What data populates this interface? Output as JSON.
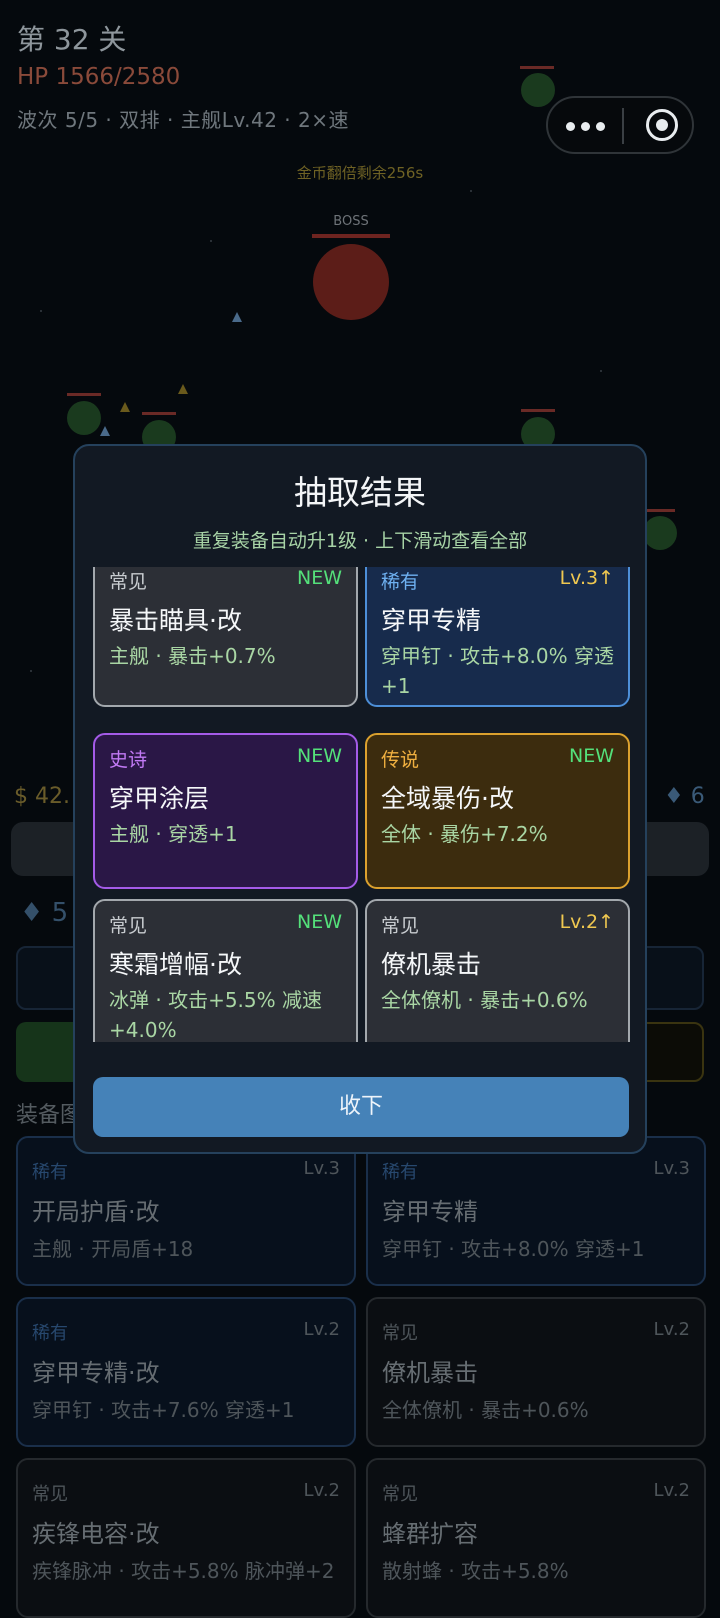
{
  "hud": {
    "title": "第 32 关",
    "hp": "HP 1566/2580",
    "info": "波次 5/5 · 双排 · 主舰Lv.42 · 2×速",
    "banner": "金币翻倍剩余256s",
    "boss_label": "BOSS"
  },
  "background": {
    "money": "$ 42.",
    "gem_count": "6",
    "gem_count_2": "5",
    "section_title": "装备图",
    "equipment": [
      {
        "rarity": "稀有",
        "level": "Lv.3",
        "name": "开局护盾·改",
        "desc": "主舰 · 开局盾+18"
      },
      {
        "rarity": "稀有",
        "level": "Lv.3",
        "name": "穿甲专精",
        "desc": "穿甲钉 · 攻击+8.0% 穿透+1"
      },
      {
        "rarity": "稀有",
        "level": "Lv.2",
        "name": "穿甲专精·改",
        "desc": "穿甲钉 · 攻击+7.6% 穿透+1"
      },
      {
        "rarity": "常见",
        "level": "Lv.2",
        "name": "僚机暴击",
        "desc": "全体僚机 · 暴击+0.6%"
      },
      {
        "rarity": "常见",
        "level": "Lv.2",
        "name": "疾锋电容·改",
        "desc": "疾锋脉冲 · 攻击+5.8% 脉冲弹+2"
      },
      {
        "rarity": "常见",
        "level": "Lv.2",
        "name": "蜂群扩容",
        "desc": "散射蜂 · 攻击+5.8%"
      }
    ]
  },
  "modal": {
    "title": "抽取结果",
    "subtitle": "重复装备自动升1级 · 上下滑动查看全部",
    "confirm_label": "收下",
    "cards": [
      {
        "rarity": "常见",
        "status": "NEW",
        "name": "暴击瞄具·改",
        "desc": "主舰 · 暴击+0.7%"
      },
      {
        "rarity": "稀有",
        "status": "Lv.3↑",
        "name": "穿甲专精",
        "desc": "穿甲钉 · 攻击+8.0% 穿透+1"
      },
      {
        "rarity": "史诗",
        "status": "NEW",
        "name": "穿甲涂层",
        "desc": "主舰 · 穿透+1"
      },
      {
        "rarity": "传说",
        "status": "NEW",
        "name": "全域暴伤·改",
        "desc": "全体 · 暴伤+7.2%"
      },
      {
        "rarity": "常见",
        "status": "NEW",
        "name": "寒霜增幅·改",
        "desc": "冰弹 · 攻击+5.5% 减速+4.0%"
      },
      {
        "rarity": "常见",
        "status": "Lv.2↑",
        "name": "僚机暴击",
        "desc": "全体僚机 · 暴击+0.6%"
      }
    ]
  },
  "colors": {
    "common": "#a3a8ad",
    "rare": "#4d8fd8",
    "epic": "#a45be8",
    "legendary": "#dba12e",
    "new_badge": "#54e07a",
    "levelup_badge": "#f0c850",
    "confirm_button": "#4582b8"
  }
}
